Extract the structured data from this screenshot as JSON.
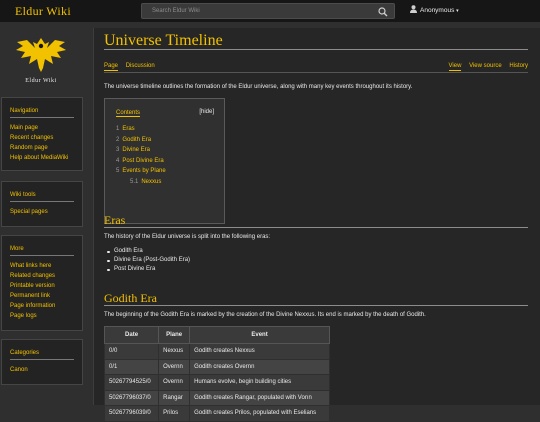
{
  "brand": "Eldur Wiki",
  "search": {
    "placeholder": "Search Eldur Wiki"
  },
  "user": {
    "label": "Anonymous"
  },
  "logo": {
    "caption": "Eldur Wiki"
  },
  "sidebar": {
    "navigation": {
      "title": "Navigation",
      "items": [
        "Main page",
        "Recent changes",
        "Random page",
        "Help about MediaWiki"
      ]
    },
    "wiki_tools": {
      "title": "Wiki tools",
      "items": [
        "Special pages"
      ]
    },
    "more": {
      "title": "More",
      "items": [
        "What links here",
        "Related changes",
        "Printable version",
        "Permanent link",
        "Page information",
        "Page logs"
      ]
    },
    "categories": {
      "title": "Categories",
      "items": [
        "Canon"
      ]
    }
  },
  "page": {
    "title": "Universe Timeline",
    "tabs_left": [
      "Page",
      "Discussion"
    ],
    "tabs_right": [
      "View",
      "View source",
      "History"
    ],
    "intro": "The universe timeline outlines the formation of the Eldur universe, along with many key events throughout its history."
  },
  "toc": {
    "title": "Contents",
    "hide": "[hide]",
    "items": [
      {
        "num": "1",
        "label": "Eras"
      },
      {
        "num": "2",
        "label": "Godith Era"
      },
      {
        "num": "3",
        "label": "Divine Era"
      },
      {
        "num": "4",
        "label": "Post Divine Era"
      },
      {
        "num": "5",
        "label": "Events by Plane"
      },
      {
        "num": "5.1",
        "label": "Nexxus"
      }
    ]
  },
  "eras": {
    "heading": "Eras",
    "text": "The history of the Eldur universe is split into the following eras:",
    "list": [
      "Godith Era",
      "Divine Era (Post-Godith Era)",
      "Post Divine Era"
    ]
  },
  "godith": {
    "heading": "Godith Era",
    "text": "The beginning of the Godith Era is marked by the creation of the Divine Nexxus. Its end is marked by the death of Godith.",
    "table": {
      "headers": [
        "Date",
        "Plane",
        "Event"
      ],
      "rows": [
        [
          "0/0",
          "Nexxus",
          "Godith creates Nexxus"
        ],
        [
          "0/1",
          "Overnn",
          "Godith creates Overnn"
        ],
        [
          "50267794525/0",
          "Overnn",
          "Humans evolve, begin building cities"
        ],
        [
          "50267796037/0",
          "Rangar",
          "Godith creates Rangar, populated with Vorın"
        ],
        [
          "50267796039/0",
          "Prilos",
          "Godith creates Prilos, populated with Eselians"
        ]
      ]
    }
  },
  "colors": {
    "accent": "#f2c100",
    "background": "#2f2f2f"
  }
}
